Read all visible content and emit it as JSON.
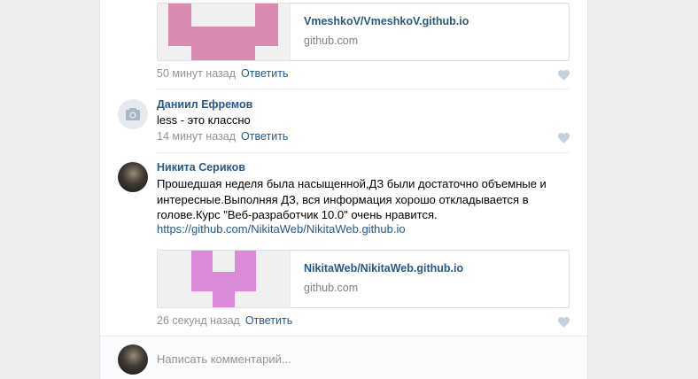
{
  "comments": [
    {
      "snippet": {
        "title": "VmeshkoV/VmeshkoV.github.io",
        "domain": "github.com",
        "identicon_color": "#d88ab0"
      },
      "time": "50 минут назад",
      "reply_label": "Ответить"
    },
    {
      "author": "Даниил Ефремов",
      "avatar": "camera-icon",
      "text": "less - это классно",
      "time": "14 минут назад",
      "reply_label": "Ответить"
    },
    {
      "author": "Никита Сериков",
      "avatar": "user-photo",
      "text": "Прошедшая неделя была насыщенной,ДЗ были достаточно объемные и интересные.Выполняя ДЗ, вся информация хорошо откладывается в голове.Курс \"Веб-разработчик 10.0\" очень нравится.",
      "link": "https://github.com/NikitaWeb/NikitaWeb.github.io",
      "snippet": {
        "title": "NikitaWeb/NikitaWeb.github.io",
        "domain": "github.com",
        "identicon_color": "#d98bd7"
      },
      "time": "26 секунд назад",
      "reply_label": "Ответить"
    }
  ],
  "composer": {
    "placeholder": "Написать комментарий..."
  },
  "icons": {
    "like": "heart-icon",
    "camera": "camera-icon"
  },
  "colors": {
    "link": "#2a5885",
    "meta": "#939393",
    "like": "#c5d0db"
  }
}
